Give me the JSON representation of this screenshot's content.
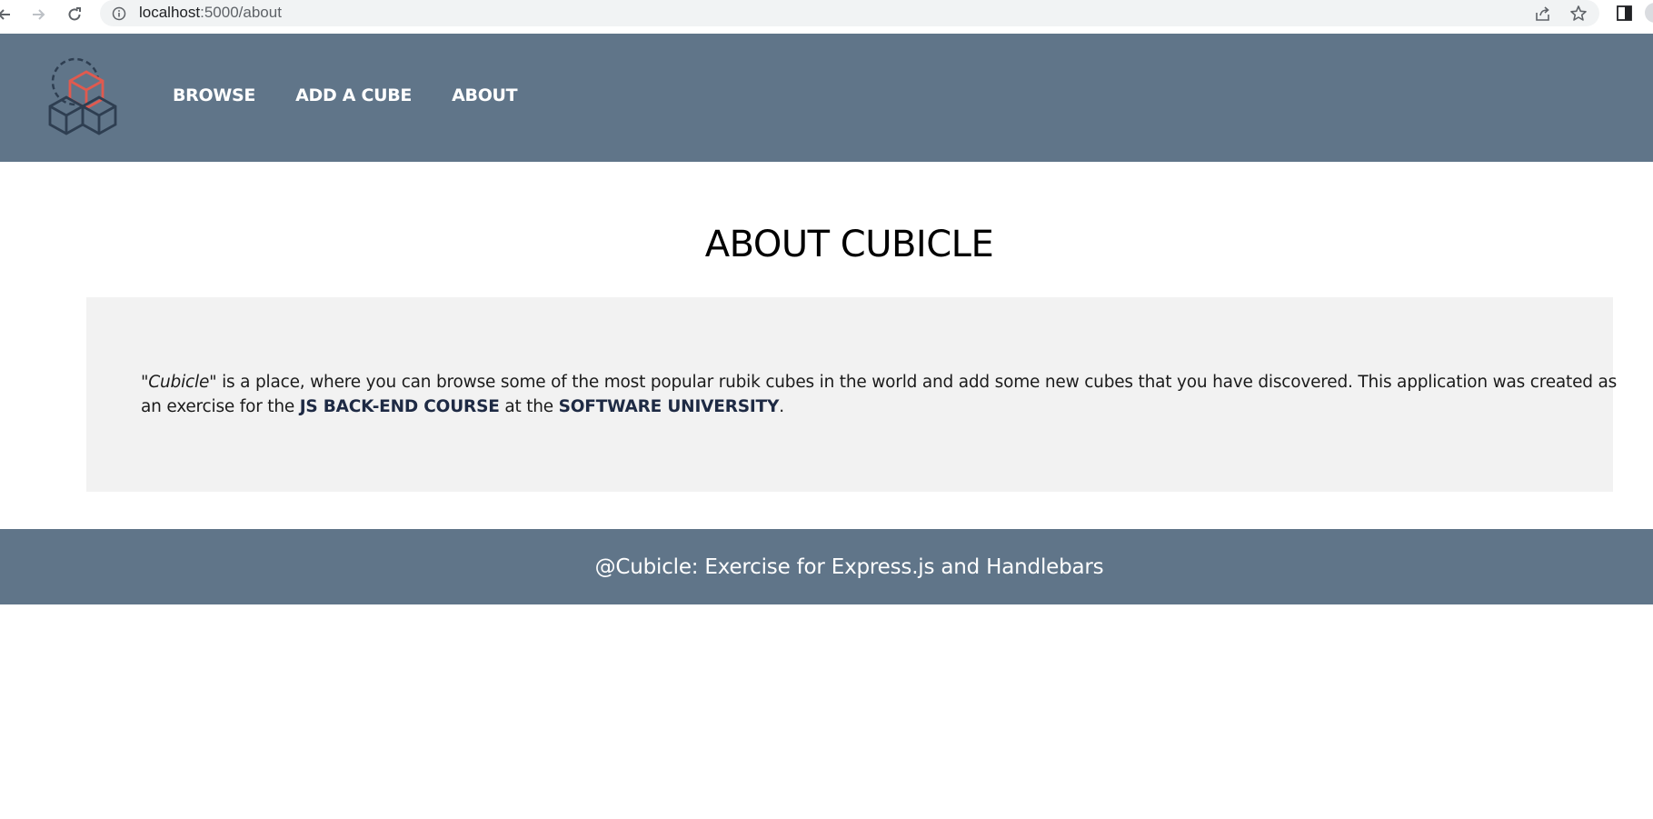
{
  "browser": {
    "url_host": "localhost",
    "url_path": ":5000/about"
  },
  "nav": {
    "items": [
      {
        "label": "BROWSE"
      },
      {
        "label": "ADD A CUBE"
      },
      {
        "label": "ABOUT"
      }
    ]
  },
  "main": {
    "title": "ABOUT CUBICLE",
    "paragraph": {
      "quote": "\"Cubicle\"",
      "text1": " is a place, where you can browse some of the most popular rubik cubes in the world and add some new cubes that you have discovered. This application was created as an exercise for the ",
      "course": "JS BACK-END COURSE",
      "text2": " at the ",
      "university": "SOFTWARE UNIVERSITY",
      "text3": "."
    }
  },
  "footer": {
    "text": "@Cubicle: Exercise for Express.js and Handlebars"
  },
  "colors": {
    "header_bg": "#607589",
    "logo_accent": "#e05a4f",
    "logo_dark": "#2e3e51",
    "content_bg": "#f2f2f2"
  },
  "icons": [
    "back-arrow-icon",
    "forward-arrow-icon",
    "reload-icon",
    "info-icon",
    "share-icon",
    "star-icon",
    "side-panel-icon",
    "cubicle-logo-icon"
  ]
}
